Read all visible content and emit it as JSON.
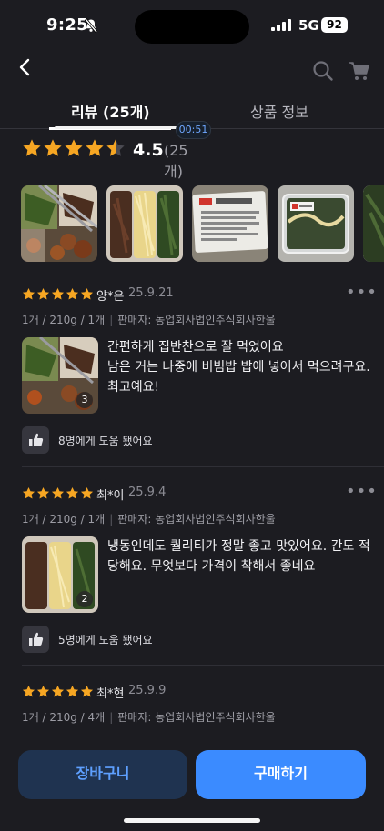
{
  "status_bar": {
    "time": "9:25",
    "network": "5G",
    "battery": "92"
  },
  "tabs": [
    {
      "label": "리뷰 (25개)"
    },
    {
      "label": "상품 정보"
    }
  ],
  "video": {
    "time": "00:51"
  },
  "summary": {
    "rating": "4.5",
    "count": "(25개)",
    "stars": 4.5
  },
  "colors": {
    "star": "#f6a623",
    "accent": "#3b8bff",
    "background": "#1c1c21"
  },
  "reviews": [
    {
      "name": "양*은",
      "date": "25.9.21",
      "option": "1개 / 210g / 1개",
      "seller": "판매자: 농업회사법인주식회사한울",
      "photo_count": "3",
      "text": "간편하게 집반찬으로 잘 먹었어요\n남은 거는 나중에 비빔밥 밥에 넣어서 먹으려구요. 최고예요!",
      "helpful": "8명에게 도움 됐어요"
    },
    {
      "name": "최*이",
      "date": "25.9.4",
      "option": "1개 / 210g / 1개",
      "seller": "판매자: 농업회사법인주식회사한울",
      "photo_count": "2",
      "text": "냉동인데도 퀄리티가 정말 좋고 맛있어요. 간도 적당해요. 무엇보다 가격이 착해서 좋네요",
      "helpful": "5명에게 도움 됐어요"
    },
    {
      "name": "최*현",
      "date": "25.9.9",
      "option": "1개 / 210g / 4개",
      "seller": "판매자: 농업회사법인주식회사한울"
    }
  ],
  "buttons": {
    "cart": "장바구니",
    "buy": "구매하기"
  }
}
